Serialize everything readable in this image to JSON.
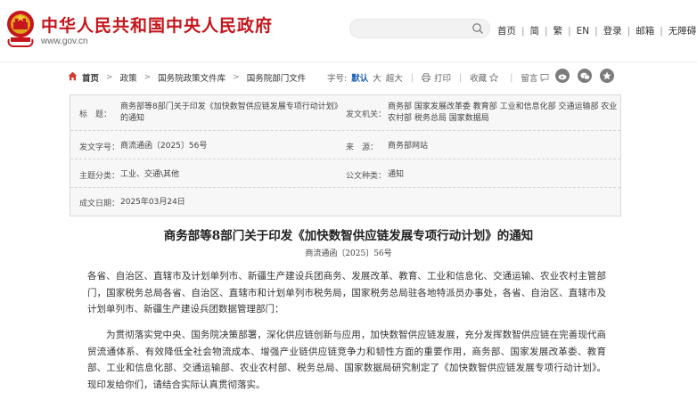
{
  "header": {
    "site_title": "中华人民共和国中央人民政府",
    "site_url": "www.gov.cn",
    "search": {
      "placeholder": ""
    },
    "links": [
      "首页",
      "简",
      "繁",
      "EN",
      "登录",
      "邮箱",
      "无障碍"
    ]
  },
  "breadcrumb": {
    "items": [
      "首页",
      "政策",
      "国务院政策文件库",
      "国务院部门文件"
    ]
  },
  "tools": {
    "font_label": "字号:",
    "font_sizes": [
      "默认",
      "大",
      "超大"
    ],
    "print": "打印",
    "collect": "收藏",
    "message": "留言"
  },
  "info": {
    "title_label": "标　题：",
    "title_value": "商务部等8部门关于印发《加快数智供应链发展专项行动计划》的通知",
    "issuer_label": "发文机关：",
    "issuer_value": "商务部 国家发展改革委 教育部 工业和信息化部 交通运输部 农业农村部 税务总局 国家数据局",
    "docno_label": "发文字号：",
    "docno_value": "商流通函〔2025〕56号",
    "source_label": "来　源：",
    "source_value": "商务部网站",
    "topic_label": "主题分类：",
    "topic_value": "工业、交通\\其他",
    "type_label": "公文种类：",
    "type_value": "通知",
    "date_label": "成文日期：",
    "date_value": "2025年03月24日"
  },
  "article": {
    "title": "商务部等8部门关于印发《加快数智供应链发展专项行动计划》的通知",
    "docno": "商流通函〔2025〕56号",
    "para1": "各省、自治区、直辖市及计划单列市、新疆生产建设兵团商务、发展改革、教育、工业和信息化、交通运输、农业农村主管部门，国家税务总局各省、自治区、直辖市和计划单列市税务局，国家税务总局驻各地特派员办事处，各省、自治区、直辖市及计划单列市、新疆生产建设兵团数据管理部门：",
    "para2": "为贯彻落实党中央、国务院决策部署，深化供应链创新与应用，加快数智供应链发展，充分发挥数智供应链在完善现代商贸流通体系、有效降低全社会物流成本、增强产业链供应链竞争力和韧性方面的重要作用，商务部、国家发展改革委、教育部、工业和信息化部、交通运输部、农业农村部、税务总局、国家数据局研究制定了《加快数智供应链发展专项行动计划》。现印发给你们，请结合实际认真贯彻落实。"
  },
  "colors": {
    "brand_red": "#c4161c",
    "accent_blue": "#1a5fb4",
    "table_bg": "#f7f7f7"
  },
  "icons": [
    "national-emblem-icon",
    "search-icon",
    "home-icon",
    "print-icon",
    "star-icon",
    "comment-icon",
    "weibo-icon",
    "wechat-icon",
    "qzone-icon"
  ]
}
